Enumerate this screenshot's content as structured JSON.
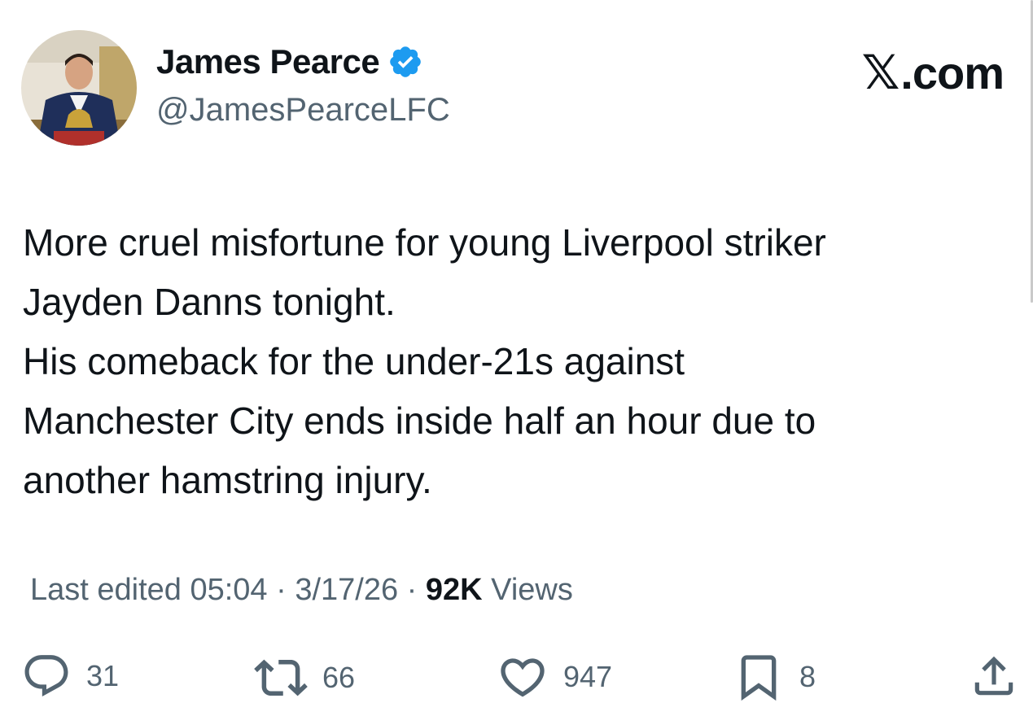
{
  "author": {
    "display_name": "James Pearce",
    "handle": "@JamesPearceLFC",
    "verified": true,
    "avatar_icon": "profile-photo"
  },
  "brand": {
    "x_glyph": "𝕏",
    "domain": ".com"
  },
  "tweet": {
    "lines": [
      "More cruel misfortune for young Liverpool striker",
      "Jayden Danns tonight.",
      "His comeback for the under-21s against",
      "Manchester City ends inside half an hour due to",
      "another hamstring injury."
    ]
  },
  "meta": {
    "edited_label": "Last edited 05:04 · 3/17/26",
    "separator": " · ",
    "views_count": "92K",
    "views_label": " Views"
  },
  "actions": {
    "replies": "31",
    "reposts": "66",
    "likes": "947",
    "bookmarks": "8"
  },
  "colors": {
    "verified": "#1d9bf0",
    "secondary_text": "#536471",
    "primary_text": "#0f1419"
  }
}
